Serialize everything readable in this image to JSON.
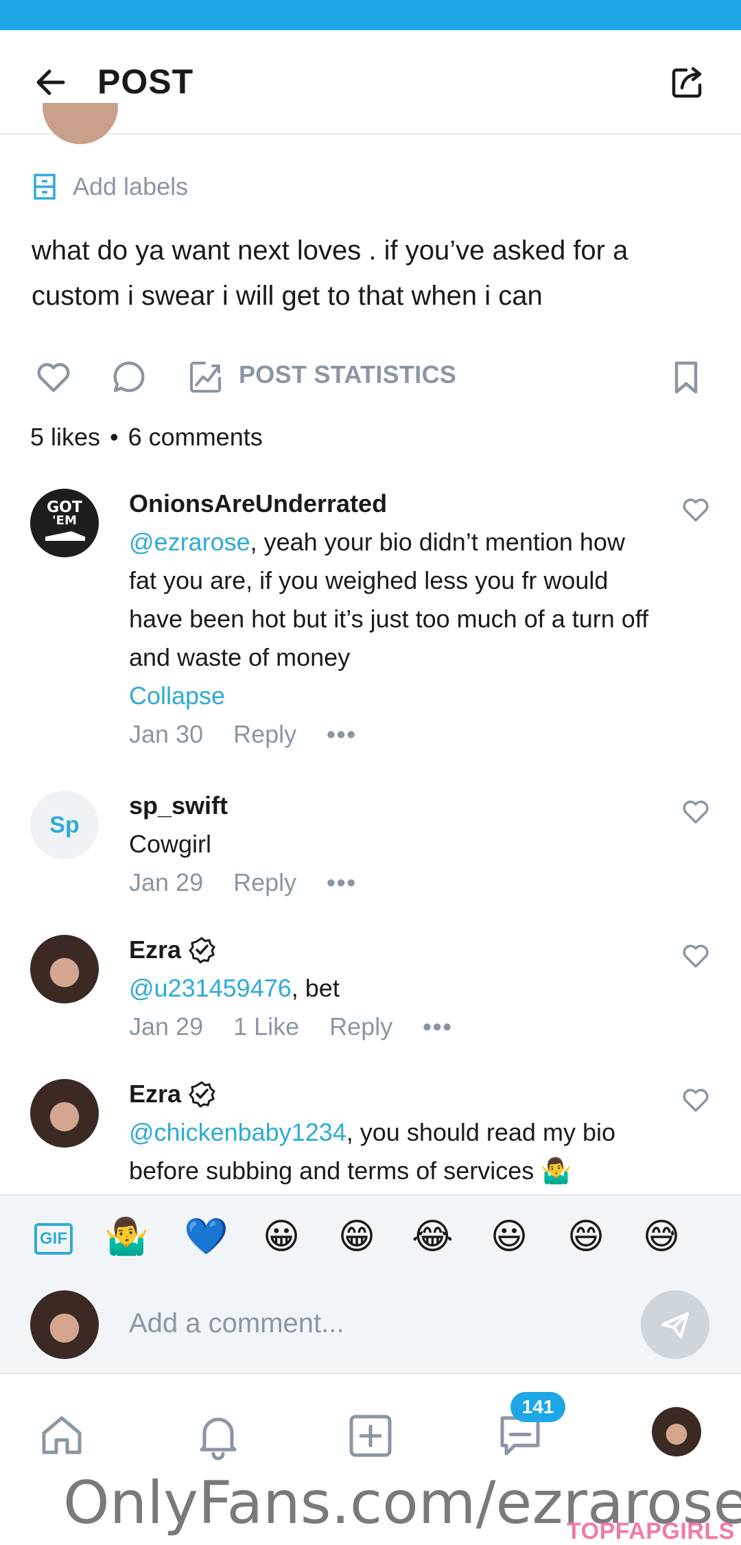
{
  "header": {
    "title": "POST",
    "back_icon": "arrow-left-icon",
    "share_icon": "share-icon"
  },
  "labels": {
    "text": "Add labels"
  },
  "post": {
    "text": "what do ya want next loves . if you’ve asked for a custom i swear i will get to that when i can"
  },
  "actions": {
    "stats_label": "POST STATISTICS"
  },
  "counts": {
    "likes": "5 likes",
    "separator": "•",
    "comments": "6 comments"
  },
  "comments": [
    {
      "author": "OnionsAreUnderrated",
      "mention": "@ezrarose",
      "text": ", yeah your bio didn’t mention how fat you are, if you weighed less you fr would have been hot but it’s just too much of a turn off and waste of money",
      "collapse": "Collapse",
      "date": "Jan 30",
      "likes": "",
      "reply": "Reply",
      "more": "•••"
    },
    {
      "author": "sp_swift",
      "avatar_initials": "Sp",
      "text": "Cowgirl",
      "date": "Jan 29",
      "reply": "Reply",
      "more": "•••"
    },
    {
      "author": "Ezra",
      "mention": "@u231459476",
      "text": ", bet",
      "date": "Jan 29",
      "likes": "1 Like",
      "reply": "Reply",
      "more": "•••"
    },
    {
      "author": "Ezra",
      "mention": "@chickenbaby1234",
      "text": ", you should read my bio before subbing and terms of services 🤷‍♂️"
    }
  ],
  "emoji_bar": {
    "gif_label": "GIF",
    "emojis": [
      "🤷‍♂️",
      "💙",
      "😀",
      "😁",
      "😂",
      "😃",
      "😄",
      "😅"
    ]
  },
  "comment_input": {
    "placeholder": "Add a comment..."
  },
  "nav": {
    "badge_count": "141"
  },
  "watermark": {
    "text": "OnlyFans.com/ezrarose",
    "brand": "TOPFAPGIRLS"
  },
  "colors": {
    "accent": "#1ea7e6",
    "link": "#2eaad6",
    "muted": "#8a96a3"
  }
}
